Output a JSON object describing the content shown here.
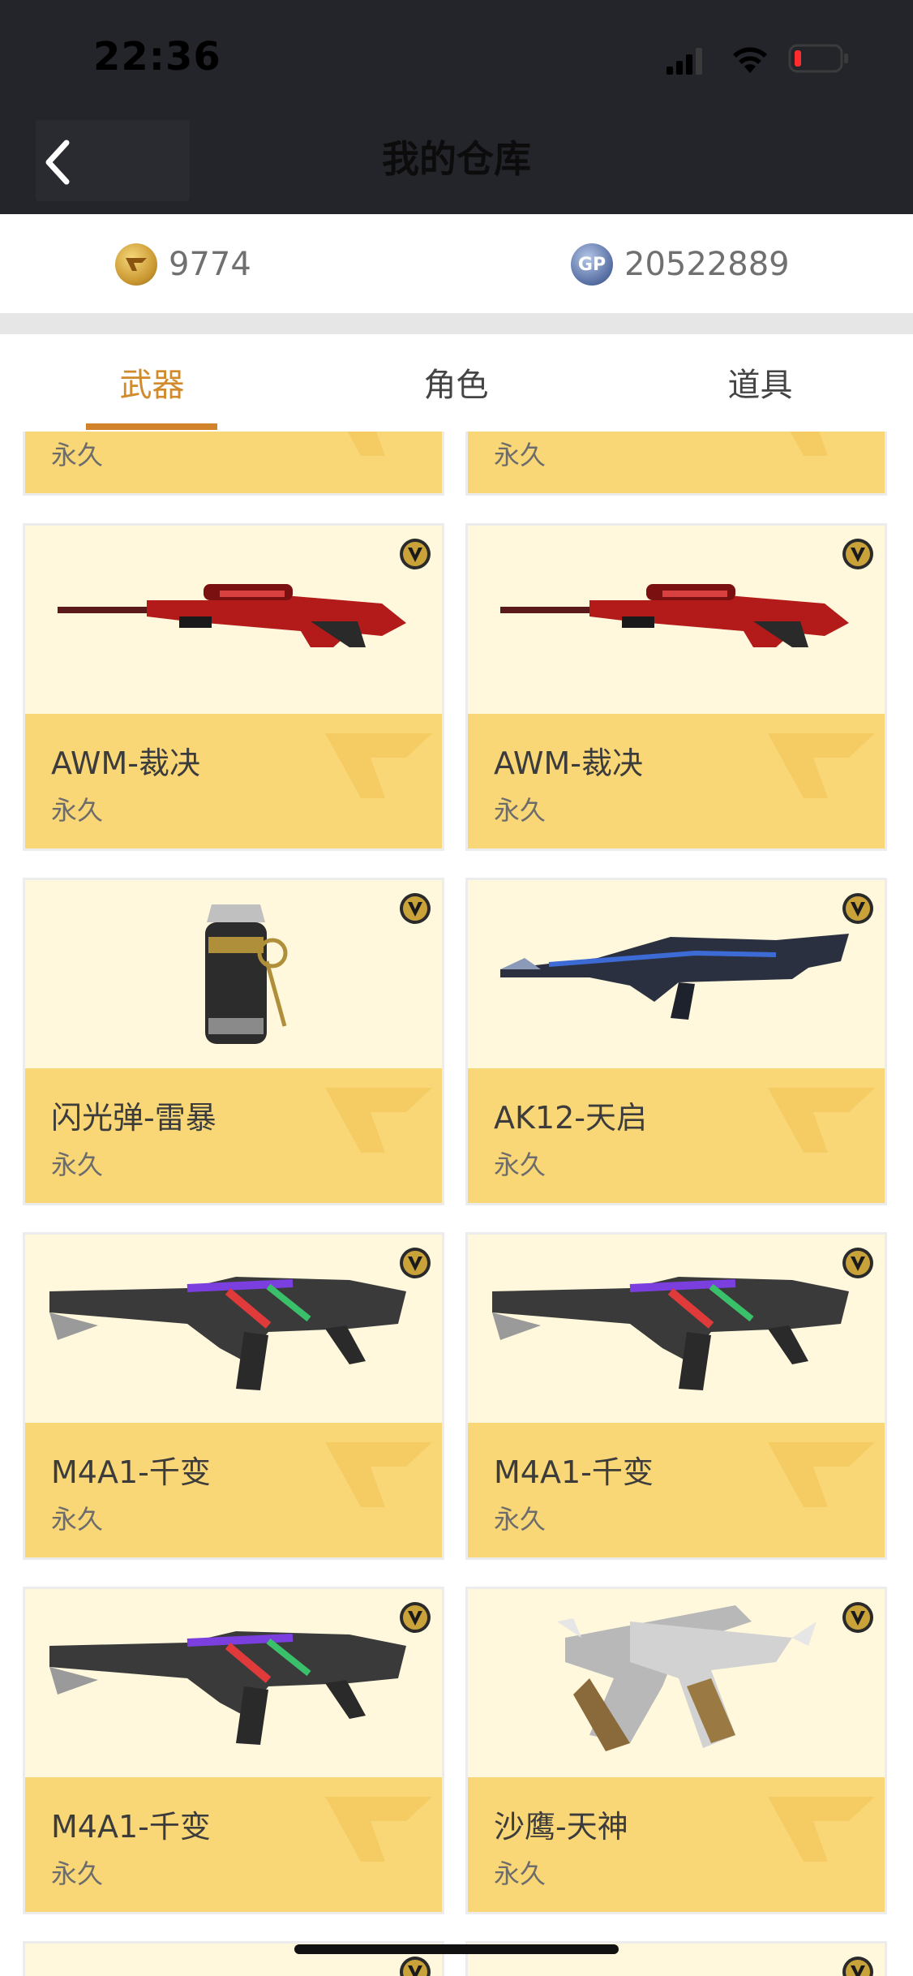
{
  "status_bar": {
    "time": "22:36"
  },
  "header": {
    "title": "我的仓库",
    "back_icon": "chevron-left-icon"
  },
  "currency": {
    "cf": {
      "icon": "cf-coin-icon",
      "value": "9774"
    },
    "gp": {
      "icon": "gp-coin-icon",
      "icon_label": "GP",
      "value": "20522889"
    }
  },
  "tabs": [
    {
      "label": "武器",
      "active": true
    },
    {
      "label": "角色",
      "active": false
    },
    {
      "label": "道具",
      "active": false
    }
  ],
  "partial_top": [
    {
      "duration": "永久"
    },
    {
      "duration": "永久"
    }
  ],
  "items": [
    {
      "name": "AWM-裁决",
      "duration": "永久",
      "weapon": "awm-sniper",
      "badge": "V"
    },
    {
      "name": "AWM-裁决",
      "duration": "永久",
      "weapon": "awm-sniper",
      "badge": "V"
    },
    {
      "name": "闪光弹-雷暴",
      "duration": "永久",
      "weapon": "flash-grenade",
      "badge": "V"
    },
    {
      "name": "AK12-天启",
      "duration": "永久",
      "weapon": "ak12-rifle",
      "badge": "V"
    },
    {
      "name": "M4A1-千变",
      "duration": "永久",
      "weapon": "m4a1-rifle",
      "badge": "V"
    },
    {
      "name": "M4A1-千变",
      "duration": "永久",
      "weapon": "m4a1-rifle",
      "badge": "V"
    },
    {
      "name": "M4A1-千变",
      "duration": "永久",
      "weapon": "m4a1-rifle",
      "badge": "V"
    },
    {
      "name": "沙鹰-天神",
      "duration": "永久",
      "weapon": "desert-eagle-pistols",
      "badge": "V"
    }
  ],
  "colors": {
    "accent": "#d2822a",
    "card_top": "#fff8dd",
    "card_bottom": "#fad776",
    "header_bg": "#24252a"
  }
}
